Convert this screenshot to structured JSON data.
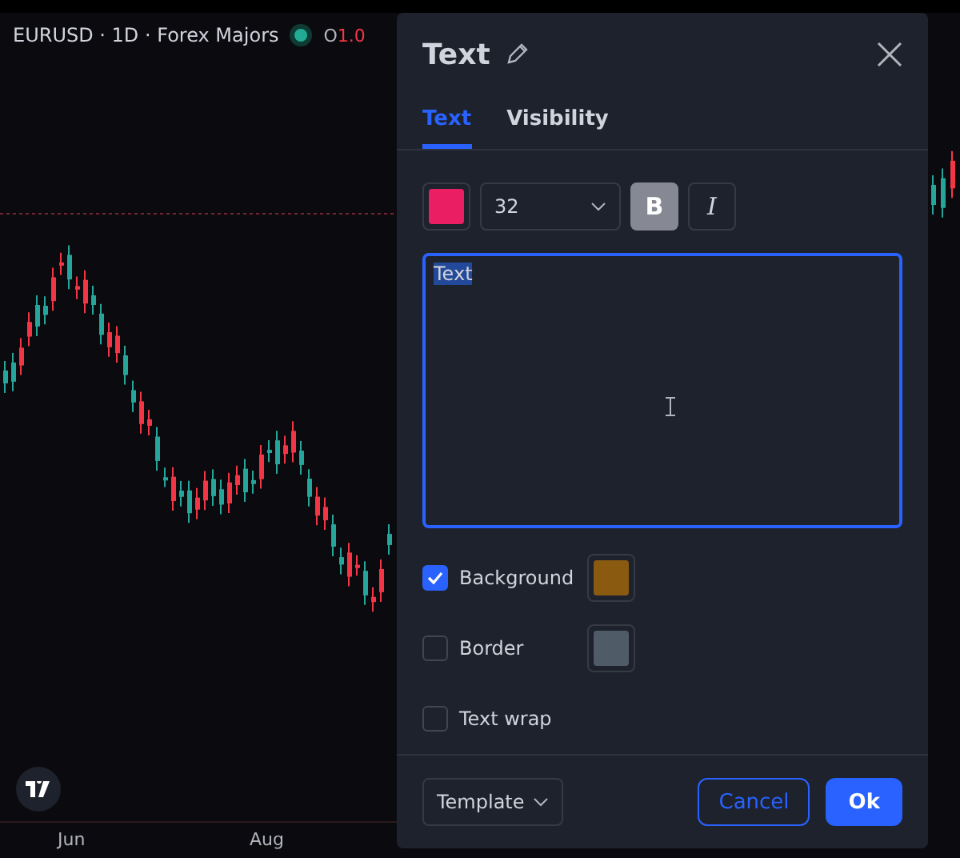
{
  "chart": {
    "symbol": "EURUSD · 1D · Forex Majors",
    "open_label": "O",
    "open_value": "1.0",
    "x_labels": [
      "Jun",
      "Aug"
    ]
  },
  "dialog": {
    "title": "Text",
    "tabs": [
      {
        "label": "Text",
        "selected": true
      },
      {
        "label": "Visibility",
        "selected": false
      }
    ],
    "swatch": {
      "color": "#e91e63"
    },
    "font_size": "32",
    "bold_label": "B",
    "bold": true,
    "italic_label": "I",
    "italic": false,
    "text_value": "Text",
    "options": [
      {
        "label": "Background",
        "checked": true,
        "color": "#8a5a10"
      },
      {
        "label": "Border",
        "checked": false,
        "color": "#4f5b66"
      },
      {
        "label": "Text wrap",
        "checked": false
      }
    ],
    "template": "Template",
    "cancel": "Cancel",
    "ok": "Ok"
  }
}
